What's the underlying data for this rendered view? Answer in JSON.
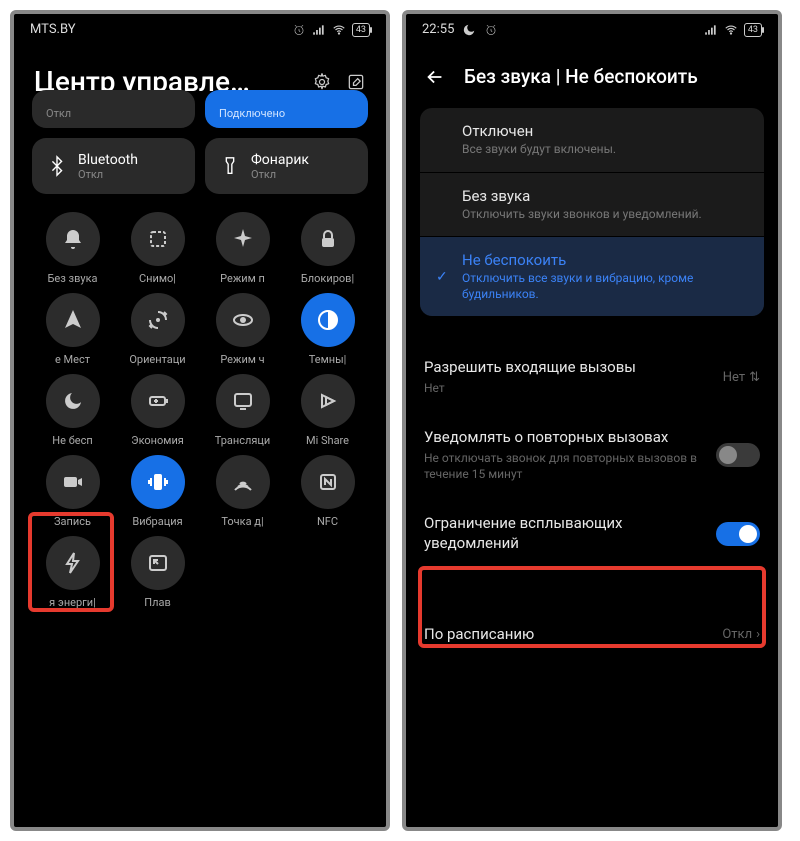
{
  "left": {
    "status": {
      "carrier": "MTS.BY",
      "battery": "43"
    },
    "title": "Центр управле…",
    "tiles_top": [
      {
        "title": "",
        "sub": "Откл",
        "state": "off"
      },
      {
        "title": "",
        "sub": "Подключено",
        "state": "blue"
      }
    ],
    "tiles_wide": [
      {
        "icon": "bluetooth",
        "title": "Bluetooth",
        "sub": "Откл"
      },
      {
        "icon": "flashlight",
        "title": "Фонарик",
        "sub": "Откл"
      }
    ],
    "grid": [
      {
        "icon": "bell",
        "label": "Без звука"
      },
      {
        "icon": "screenshot",
        "label": "Снимо|"
      },
      {
        "icon": "airplane",
        "label": "Режим п"
      },
      {
        "icon": "lock",
        "label": "Блокиров|"
      },
      {
        "icon": "location",
        "label": "е   Мест"
      },
      {
        "icon": "rotation",
        "label": "Ориентаци"
      },
      {
        "icon": "eye",
        "label": "Режим ч"
      },
      {
        "icon": "theme",
        "label": "Темны|",
        "blue": true
      },
      {
        "icon": "moon",
        "label": "Не бесп"
      },
      {
        "icon": "battery-saver",
        "label": "Экономия"
      },
      {
        "icon": "cast",
        "label": "Трансляци"
      },
      {
        "icon": "mishare",
        "label": "Mi Share"
      },
      {
        "icon": "record",
        "label": "Запись"
      },
      {
        "icon": "vibrate",
        "label": "Вибрация",
        "blue": true
      },
      {
        "icon": "hotspot",
        "label": "Точка д|"
      },
      {
        "icon": "nfc",
        "label": "NFC"
      },
      {
        "icon": "bolt",
        "label": "я энерги|"
      },
      {
        "icon": "pip",
        "label": "Плав"
      }
    ]
  },
  "right": {
    "status": {
      "time": "22:55",
      "battery": "43"
    },
    "title": "Без звука | Не беспокоить",
    "options": [
      {
        "title": "Отключен",
        "sub": "Все звуки будут включены."
      },
      {
        "title": "Без звука",
        "sub": "Отключить звуки звонков и уведомлений."
      },
      {
        "title": "Не беспокоить",
        "sub": "Отключить все звуки и вибрацию, кроме будильников.",
        "active": true
      }
    ],
    "settings": {
      "allow_calls": {
        "t": "Разрешить входящие вызовы",
        "s": "Нет",
        "v": "Нет"
      },
      "repeat": {
        "t": "Уведомлять о повторных вызовах",
        "s": "Не отключать звонок для повторных вызовов в течение 15 минут"
      },
      "popup": {
        "t": "Ограничение всплывающих уведомлений"
      },
      "schedule": {
        "t": "По расписанию",
        "v": "Откл"
      }
    }
  }
}
